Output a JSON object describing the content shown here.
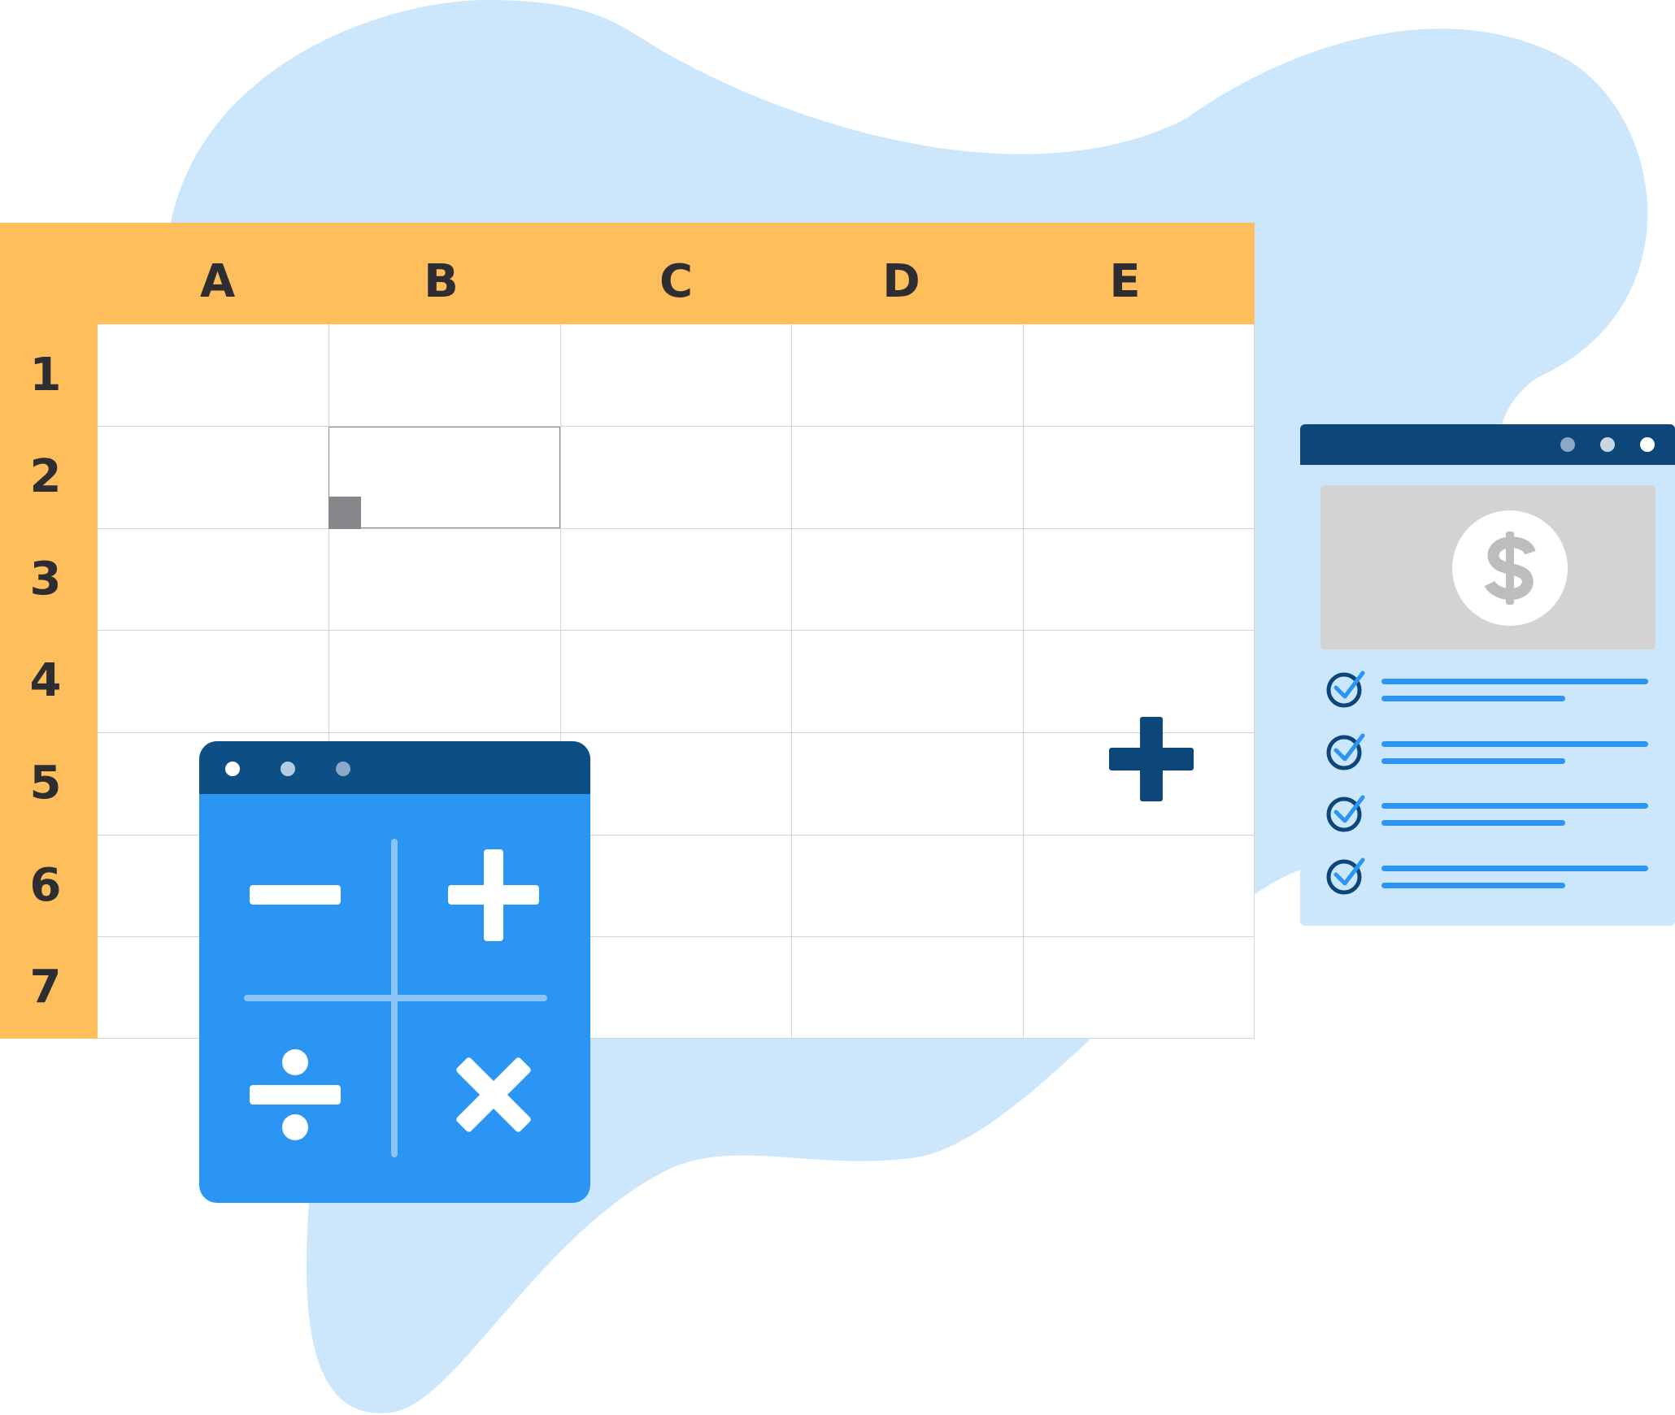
{
  "colors": {
    "background_blob": "#CCE7FC",
    "sheet_header": "#FEBE5B",
    "header_text": "#2D2D32",
    "grid_line": "#D5D5D5",
    "fill_handle": "#88878C",
    "calculator_body": "#2B95F4",
    "calculator_titlebar": "#0D4E84",
    "invoice_titlebar": "#0D4679",
    "invoice_body": "#CCE7FC",
    "check_line": "#2B95F4",
    "check_circle": "#0D4679"
  },
  "spreadsheet": {
    "columns": [
      "A",
      "B",
      "C",
      "D",
      "E"
    ],
    "rows": [
      "1",
      "2",
      "3",
      "4",
      "5",
      "6",
      "7"
    ],
    "selected_cell": "B2"
  },
  "calculator": {
    "window_controls": [
      "dot",
      "dot",
      "dot"
    ],
    "keys": [
      "minus-icon",
      "plus-icon",
      "divide-icon",
      "multiply-icon"
    ]
  },
  "invoice": {
    "window_controls": [
      "dot",
      "dot",
      "dot"
    ],
    "image_icon": "dollar-coin-icon",
    "checklist_items": 4
  },
  "cursor_icon": "plus-cursor-icon"
}
